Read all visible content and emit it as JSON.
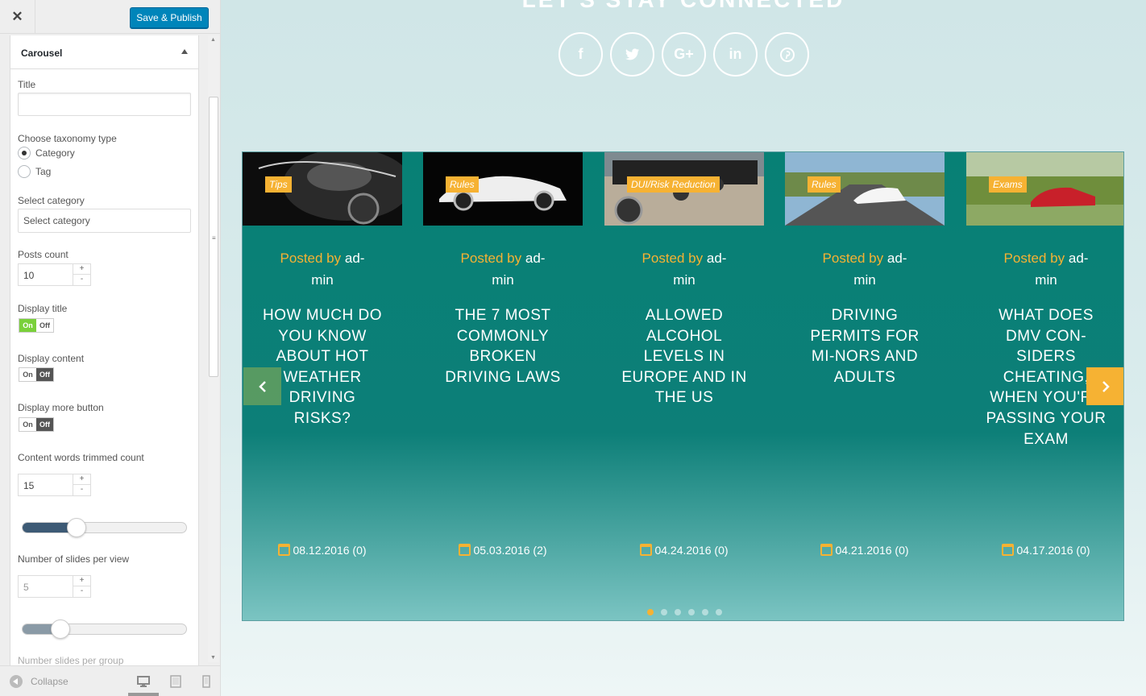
{
  "toolbar": {
    "close_label": "✕",
    "publish_label": "Save & Publish"
  },
  "section": {
    "title": "Carousel"
  },
  "form": {
    "title_label": "Title",
    "title_value": "",
    "taxonomy_label": "Choose taxonomy type",
    "taxonomy_options": [
      "Category",
      "Tag"
    ],
    "taxonomy_selected": "Category",
    "category_label": "Select category",
    "category_value": "Select category",
    "posts_count_label": "Posts count",
    "posts_count_value": "10",
    "display_title_label": "Display title",
    "display_title": "on",
    "display_content_label": "Display content",
    "display_content": "off",
    "display_more_label": "Display more button",
    "display_more": "off",
    "trim_label": "Content words trimmed count",
    "trim_value": "15",
    "trim_slider_fraction": 0.27,
    "slides_per_view_label": "Number of slides per view",
    "slides_per_view_value": "5",
    "slides_per_view_slider_fraction": 0.17,
    "slides_per_group_label": "Number slides per group",
    "toggle_on": "On",
    "toggle_off": "Off",
    "stepper_plus": "+",
    "stepper_minus": "-"
  },
  "footer": {
    "collapse_label": "Collapse",
    "devices": [
      "desktop-icon",
      "tablet-icon",
      "mobile-icon"
    ]
  },
  "preview": {
    "connect_title": "LET'S STAY CONNECTED",
    "social": [
      {
        "icon": "facebook-icon",
        "glyph": "f"
      },
      {
        "icon": "twitter-icon",
        "glyph": "t"
      },
      {
        "icon": "google-plus-icon",
        "glyph": "G+"
      },
      {
        "icon": "linkedin-icon",
        "glyph": "in"
      },
      {
        "icon": "pinterest-icon",
        "glyph": "p"
      }
    ],
    "posted_by": "Posted by",
    "author_line1": "ad-",
    "author_line2": "min",
    "slides": [
      {
        "category": "Tips",
        "title": "How much do you know about hot weather driving risks?",
        "date": "08.12.2016 (0)"
      },
      {
        "category": "Rules",
        "title": "The 7 most commonly broken driving laws",
        "date": "05.03.2016 (2)"
      },
      {
        "category": "DUI/Risk Reduction",
        "title": "Allowed alcohol levels in Europe and in the US",
        "date": "04.24.2016 (0)"
      },
      {
        "category": "Rules",
        "title": "Driving permits for mi-nors and adults",
        "date": "04.21.2016 (0)"
      },
      {
        "category": "Exams",
        "title": "What does DMV con-siders cheating, when you're passing your exam",
        "date": "04.17.2016 (0)"
      }
    ],
    "dots_count": 6,
    "active_dot": 0
  },
  "colors": {
    "accent": "#f6b233",
    "carousel_bg": "#078075",
    "publish": "#0085ba"
  }
}
